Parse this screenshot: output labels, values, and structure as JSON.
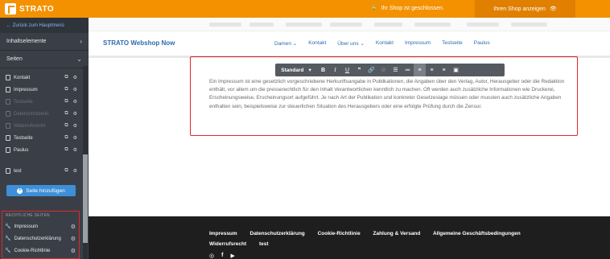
{
  "topbar": {
    "logo": "STRATO",
    "shop_status": "Ihr Shop ist geschlossen.",
    "show_shop": "Ihren Shop anzeigen"
  },
  "sidebar": {
    "back": "← Zurück zum Hauptmenü",
    "inhaltselemente": "Inhaltselemente",
    "seiten": "Seiten",
    "pages": [
      {
        "label": "Kontakt",
        "dim": false
      },
      {
        "label": "Impressum",
        "dim": false
      },
      {
        "label": "Testseite",
        "dim": true
      },
      {
        "label": "Datenschutzerkl.",
        "dim": true
      },
      {
        "label": "Widerrufsrecht",
        "dim": true
      },
      {
        "label": "Testseite",
        "dim": false
      },
      {
        "label": "Paulus",
        "dim": false
      },
      {
        "label": "test",
        "dim": false
      }
    ],
    "add_page": "Seite hinzufügen",
    "legal_title": "RECHTLICHE SEITEN",
    "legal_items": [
      "Impressum",
      "Datenschutzerklärung",
      "Cookie-Richtlinie"
    ]
  },
  "site": {
    "title": "STRATO Webshop Now",
    "nav": [
      "Damen ⌄",
      "Kontakt",
      "Über uns ⌄",
      "Kontakt",
      "Impressum",
      "Testseite",
      "Paulus"
    ]
  },
  "toolbar": {
    "style": "Standard"
  },
  "content": {
    "text": "Ein Impressum ist eine gesetzlich vorgeschriebene Herkunftsangabe in Publikationen, die Angaben über den Verlag, Autor, Herausgeber oder die Redaktion enthält, vor allem um die presserechtlich für den Inhalt Verantwortlichen kenntlich zu machen. Oft werden auch zusätzliche Informationen wie Druckerei, Erscheinungsweise, Erscheinungsort aufgeführt. Je nach Art der Publikation und konkreter Gesetzeslage müssen oder mussten auch zusätzliche Angaben enthalten sein, beispielsweise zur steuerlichen Situation des Herausgebers oder eine erfolgte Prüfung durch die Zensur."
  },
  "footer": {
    "links": [
      "Impressum",
      "Datenschutzerklärung",
      "Cookie-Richtlinie",
      "Zahlung & Versand",
      "Allgemeine Geschäftsbedingungen",
      "Widerrufsrecht",
      "test"
    ]
  },
  "colors": {
    "brand_orange": "#f39100",
    "sidebar_bg": "#3a3f47",
    "link_blue": "#2b6bb0",
    "highlight_red": "#e2262a",
    "button_blue": "#3d8fd8"
  }
}
